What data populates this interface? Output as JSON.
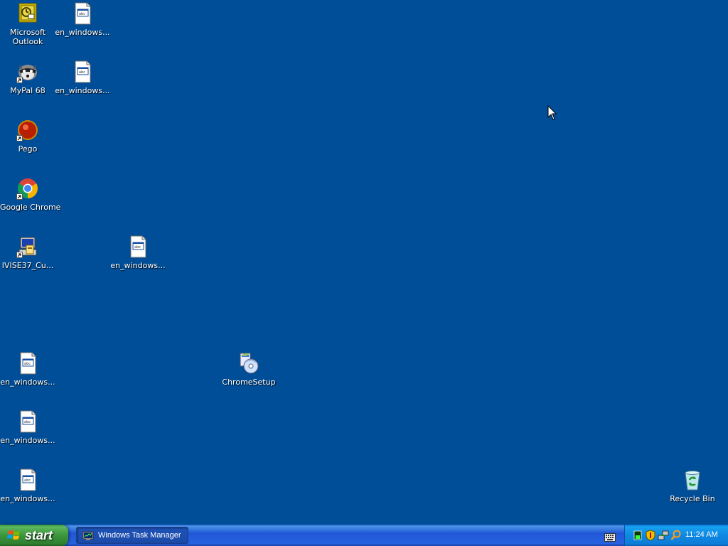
{
  "desktop": {
    "background_color": "#004e98",
    "icons": [
      {
        "label": "Microsoft Outlook",
        "icon": "outlook-icon"
      },
      {
        "label": "en_windows...",
        "icon": "document-icon"
      },
      {
        "label": "MyPal 68",
        "icon": "mypal-raccoon-icon"
      },
      {
        "label": "en_windows...",
        "icon": "document-icon"
      },
      {
        "label": "Pego",
        "icon": "pego-icon"
      },
      {
        "label": "Google Chrome",
        "icon": "chrome-icon"
      },
      {
        "label": "IVISE37_Cu...",
        "icon": "installer-icon"
      },
      {
        "label": "en_windows...",
        "icon": "document-icon"
      },
      {
        "label": "en_windows...",
        "icon": "document-icon"
      },
      {
        "label": "ChromeSetup",
        "icon": "setup-icon"
      },
      {
        "label": "en_windows...",
        "icon": "document-icon"
      },
      {
        "label": "en_windows...",
        "icon": "document-icon"
      },
      {
        "label": "Recycle Bin",
        "icon": "recycle-bin-icon"
      }
    ]
  },
  "taskbar": {
    "start_label": "start",
    "tasks": [
      {
        "label": "Windows Task Manager",
        "icon": "task-manager-icon"
      }
    ],
    "tray": {
      "icons": [
        "task-manager-cpu-icon",
        "security-shield-icon",
        "network-icon",
        "search-icon"
      ],
      "clock": "11:24 AM"
    }
  }
}
